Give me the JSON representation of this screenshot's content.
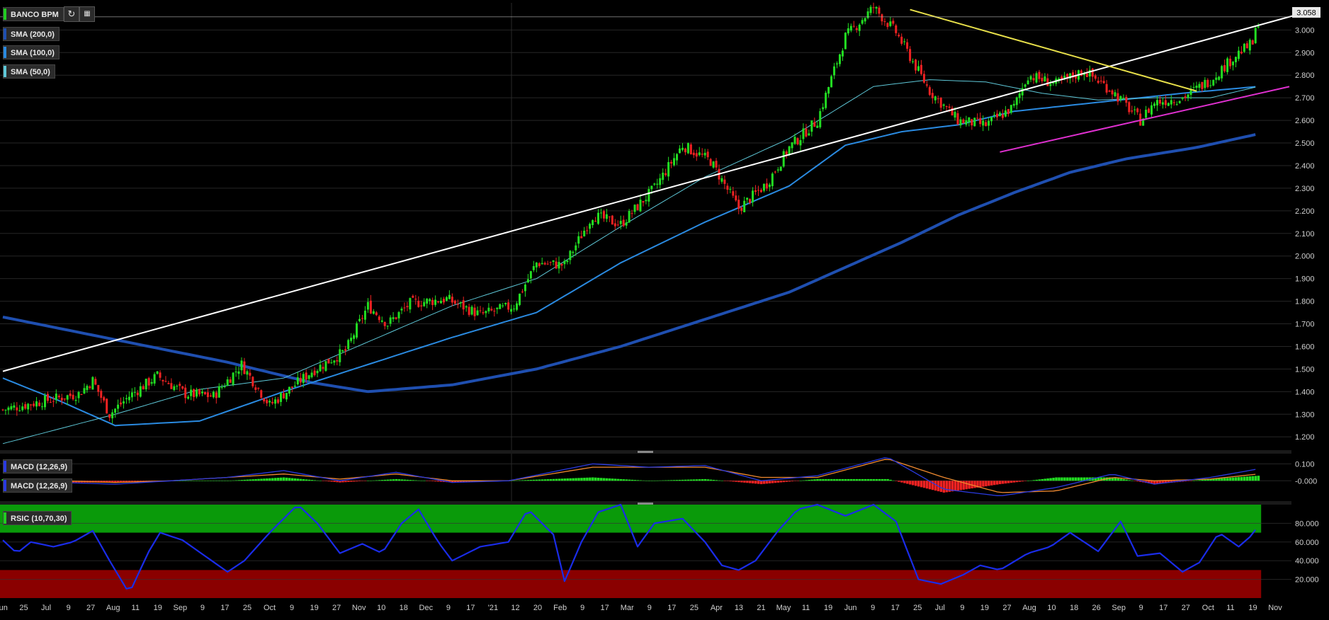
{
  "instrument": "BANCO BPM",
  "last_price_label": "3.058",
  "indicators": {
    "sma200": "SMA (200,0)",
    "sma100": "SMA (100,0)",
    "sma50": "SMA (50,0)",
    "macd_a": "MACD (12,26,9)",
    "macd_b": "MACD (12,26,9)",
    "rsi": "RSIC (10,70,30)"
  },
  "colors": {
    "up": "#22dd22",
    "down": "#ee2222",
    "sma50": "#5ec8d8",
    "sma100": "#2a8ae0",
    "sma200": "#1f4fb0",
    "trend_white": "#ffffff",
    "trend_yellow": "#e8e04a",
    "trend_magenta": "#e030d0",
    "macd_line": "#2a3ae0",
    "signal_line": "#f08a30",
    "rsi_line": "#1a2ce8",
    "overbought_zone": "#0a9a0a",
    "oversold_zone": "#8a0000"
  },
  "chart_data": [
    {
      "type": "candlestick",
      "title": "BANCO BPM",
      "ylim": [
        1.16,
        3.12
      ],
      "y_ticks": [
        "3.000",
        "2.900",
        "2.800",
        "2.700",
        "2.600",
        "2.500",
        "2.400",
        "2.300",
        "2.200",
        "2.100",
        "2.000",
        "1.900",
        "1.800",
        "1.700",
        "1.600",
        "1.500",
        "1.400",
        "1.300",
        "1.200"
      ],
      "x_ticks": [
        "Jun",
        "25",
        "Jul",
        "9",
        "27",
        "Aug",
        "11",
        "19",
        "Sep",
        "9",
        "17",
        "25",
        "Oct",
        "9",
        "19",
        "27",
        "Nov",
        "10",
        "18",
        "Dec",
        "9",
        "17",
        "'21",
        "12",
        "20",
        "Feb",
        "9",
        "17",
        "Mar",
        "9",
        "17",
        "25",
        "Apr",
        "13",
        "21",
        "May",
        "11",
        "19",
        "Jun",
        "9",
        "17",
        "25",
        "Jul",
        "9",
        "19",
        "27",
        "Aug",
        "10",
        "18",
        "26",
        "Sep",
        "9",
        "17",
        "27",
        "Oct",
        "11",
        "19",
        "Nov"
      ],
      "price_path": [
        [
          0,
          1.32
        ],
        [
          15,
          1.36
        ],
        [
          27,
          1.39
        ],
        [
          32,
          1.45
        ],
        [
          38,
          1.3
        ],
        [
          45,
          1.38
        ],
        [
          55,
          1.47
        ],
        [
          65,
          1.39
        ],
        [
          75,
          1.38
        ],
        [
          85,
          1.52
        ],
        [
          95,
          1.34
        ],
        [
          110,
          1.49
        ],
        [
          122,
          1.58
        ],
        [
          130,
          1.78
        ],
        [
          137,
          1.7
        ],
        [
          145,
          1.79
        ],
        [
          158,
          1.81
        ],
        [
          170,
          1.74
        ],
        [
          182,
          1.78
        ],
        [
          190,
          1.97
        ],
        [
          200,
          1.96
        ],
        [
          210,
          2.18
        ],
        [
          220,
          2.14
        ],
        [
          232,
          2.3
        ],
        [
          242,
          2.49
        ],
        [
          252,
          2.42
        ],
        [
          262,
          2.21
        ],
        [
          272,
          2.32
        ],
        [
          280,
          2.48
        ],
        [
          290,
          2.6
        ],
        [
          300,
          2.97
        ],
        [
          310,
          3.1
        ],
        [
          318,
          2.99
        ],
        [
          330,
          2.73
        ],
        [
          340,
          2.6
        ],
        [
          350,
          2.58
        ],
        [
          360,
          2.66
        ],
        [
          365,
          2.8
        ],
        [
          375,
          2.76
        ],
        [
          385,
          2.82
        ],
        [
          395,
          2.73
        ],
        [
          405,
          2.6
        ],
        [
          410,
          2.68
        ],
        [
          420,
          2.7
        ],
        [
          430,
          2.78
        ],
        [
          440,
          2.9
        ],
        [
          445,
          2.94
        ],
        [
          447,
          3.04
        ]
      ],
      "sma50_path": [
        [
          0,
          1.17
        ],
        [
          40,
          1.3
        ],
        [
          70,
          1.41
        ],
        [
          100,
          1.46
        ],
        [
          130,
          1.62
        ],
        [
          160,
          1.78
        ],
        [
          190,
          1.9
        ],
        [
          220,
          2.13
        ],
        [
          250,
          2.35
        ],
        [
          280,
          2.52
        ],
        [
          310,
          2.75
        ],
        [
          330,
          2.78
        ],
        [
          350,
          2.77
        ],
        [
          370,
          2.72
        ],
        [
          390,
          2.69
        ],
        [
          410,
          2.7
        ],
        [
          430,
          2.7
        ],
        [
          447,
          2.75
        ]
      ],
      "sma100_path": [
        [
          0,
          1.46
        ],
        [
          20,
          1.36
        ],
        [
          40,
          1.25
        ],
        [
          70,
          1.27
        ],
        [
          100,
          1.4
        ],
        [
          130,
          1.52
        ],
        [
          160,
          1.64
        ],
        [
          190,
          1.75
        ],
        [
          220,
          1.97
        ],
        [
          250,
          2.15
        ],
        [
          280,
          2.31
        ],
        [
          300,
          2.49
        ],
        [
          320,
          2.55
        ],
        [
          340,
          2.58
        ],
        [
          360,
          2.64
        ],
        [
          390,
          2.68
        ],
        [
          420,
          2.72
        ],
        [
          447,
          2.75
        ]
      ],
      "sma200_path": [
        [
          0,
          1.73
        ],
        [
          40,
          1.63
        ],
        [
          80,
          1.53
        ],
        [
          110,
          1.44
        ],
        [
          130,
          1.4
        ],
        [
          160,
          1.43
        ],
        [
          190,
          1.5
        ],
        [
          220,
          1.6
        ],
        [
          250,
          1.72
        ],
        [
          280,
          1.84
        ],
        [
          300,
          1.95
        ],
        [
          320,
          2.06
        ],
        [
          340,
          2.18
        ],
        [
          360,
          2.28
        ],
        [
          380,
          2.37
        ],
        [
          400,
          2.43
        ],
        [
          425,
          2.48
        ],
        [
          447,
          2.54
        ]
      ],
      "trendlines": [
        {
          "color": "white",
          "from": [
            0,
            1.49
          ],
          "to": [
            453,
            3.05
          ]
        },
        {
          "color": "yellow",
          "from": [
            323,
            3.09
          ],
          "to": [
            420,
            2.72
          ]
        },
        {
          "color": "magenta",
          "from": [
            355,
            2.46
          ],
          "to": [
            453,
            2.74
          ]
        }
      ],
      "last_price": 3.058
    },
    {
      "type": "bar+line",
      "title": "MACD (12,26,9)",
      "ylim": [
        -0.12,
        0.16
      ],
      "y_ticks": [
        "0.100",
        "-0.000"
      ],
      "macd_path": [
        [
          0,
          0.01
        ],
        [
          20,
          -0.01
        ],
        [
          40,
          -0.02
        ],
        [
          60,
          0.0
        ],
        [
          80,
          0.02
        ],
        [
          100,
          0.06
        ],
        [
          120,
          0.0
        ],
        [
          140,
          0.05
        ],
        [
          160,
          -0.01
        ],
        [
          180,
          0.0
        ],
        [
          210,
          0.1
        ],
        [
          230,
          0.08
        ],
        [
          250,
          0.09
        ],
        [
          270,
          0.0
        ],
        [
          290,
          0.03
        ],
        [
          315,
          0.14
        ],
        [
          335,
          -0.05
        ],
        [
          355,
          -0.09
        ],
        [
          375,
          -0.04
        ],
        [
          395,
          0.04
        ],
        [
          410,
          -0.02
        ],
        [
          430,
          0.02
        ],
        [
          447,
          0.07
        ]
      ],
      "signal_path": [
        [
          0,
          0.0
        ],
        [
          20,
          0.0
        ],
        [
          40,
          -0.01
        ],
        [
          60,
          0.0
        ],
        [
          80,
          0.02
        ],
        [
          100,
          0.04
        ],
        [
          120,
          0.01
        ],
        [
          140,
          0.04
        ],
        [
          160,
          0.0
        ],
        [
          180,
          0.0
        ],
        [
          210,
          0.08
        ],
        [
          230,
          0.08
        ],
        [
          250,
          0.08
        ],
        [
          270,
          0.02
        ],
        [
          290,
          0.02
        ],
        [
          315,
          0.13
        ],
        [
          335,
          0.02
        ],
        [
          355,
          -0.07
        ],
        [
          375,
          -0.06
        ],
        [
          395,
          0.02
        ],
        [
          410,
          0.0
        ],
        [
          430,
          0.01
        ],
        [
          447,
          0.04
        ]
      ]
    },
    {
      "type": "line",
      "title": "RSIC (10,70,30)",
      "ylim": [
        0,
        100
      ],
      "y_ticks": [
        "80.000",
        "60.000",
        "40.000",
        "20.000"
      ],
      "overbought": 70,
      "oversold": 30,
      "rsi_path": [
        [
          0,
          62
        ],
        [
          5,
          48
        ],
        [
          10,
          60
        ],
        [
          18,
          55
        ],
        [
          25,
          60
        ],
        [
          32,
          72
        ],
        [
          38,
          40
        ],
        [
          45,
          5
        ],
        [
          52,
          50
        ],
        [
          56,
          70
        ],
        [
          64,
          62
        ],
        [
          72,
          45
        ],
        [
          80,
          28
        ],
        [
          86,
          40
        ],
        [
          95,
          70
        ],
        [
          105,
          100
        ],
        [
          112,
          80
        ],
        [
          120,
          48
        ],
        [
          128,
          58
        ],
        [
          135,
          48
        ],
        [
          142,
          80
        ],
        [
          148,
          95
        ],
        [
          155,
          60
        ],
        [
          160,
          40
        ],
        [
          170,
          55
        ],
        [
          180,
          60
        ],
        [
          187,
          95
        ],
        [
          196,
          68
        ],
        [
          200,
          18
        ],
        [
          206,
          60
        ],
        [
          212,
          92
        ],
        [
          220,
          100
        ],
        [
          226,
          55
        ],
        [
          232,
          80
        ],
        [
          242,
          85
        ],
        [
          250,
          60
        ],
        [
          256,
          35
        ],
        [
          262,
          30
        ],
        [
          268,
          40
        ],
        [
          276,
          72
        ],
        [
          283,
          95
        ],
        [
          290,
          100
        ],
        [
          300,
          88
        ],
        [
          310,
          100
        ],
        [
          318,
          82
        ],
        [
          326,
          20
        ],
        [
          334,
          15
        ],
        [
          342,
          25
        ],
        [
          348,
          35
        ],
        [
          355,
          30
        ],
        [
          365,
          48
        ],
        [
          373,
          55
        ],
        [
          380,
          70
        ],
        [
          390,
          50
        ],
        [
          398,
          82
        ],
        [
          404,
          45
        ],
        [
          412,
          48
        ],
        [
          420,
          28
        ],
        [
          426,
          38
        ],
        [
          433,
          70
        ],
        [
          440,
          55
        ],
        [
          445,
          68
        ],
        [
          447,
          78
        ]
      ]
    }
  ]
}
